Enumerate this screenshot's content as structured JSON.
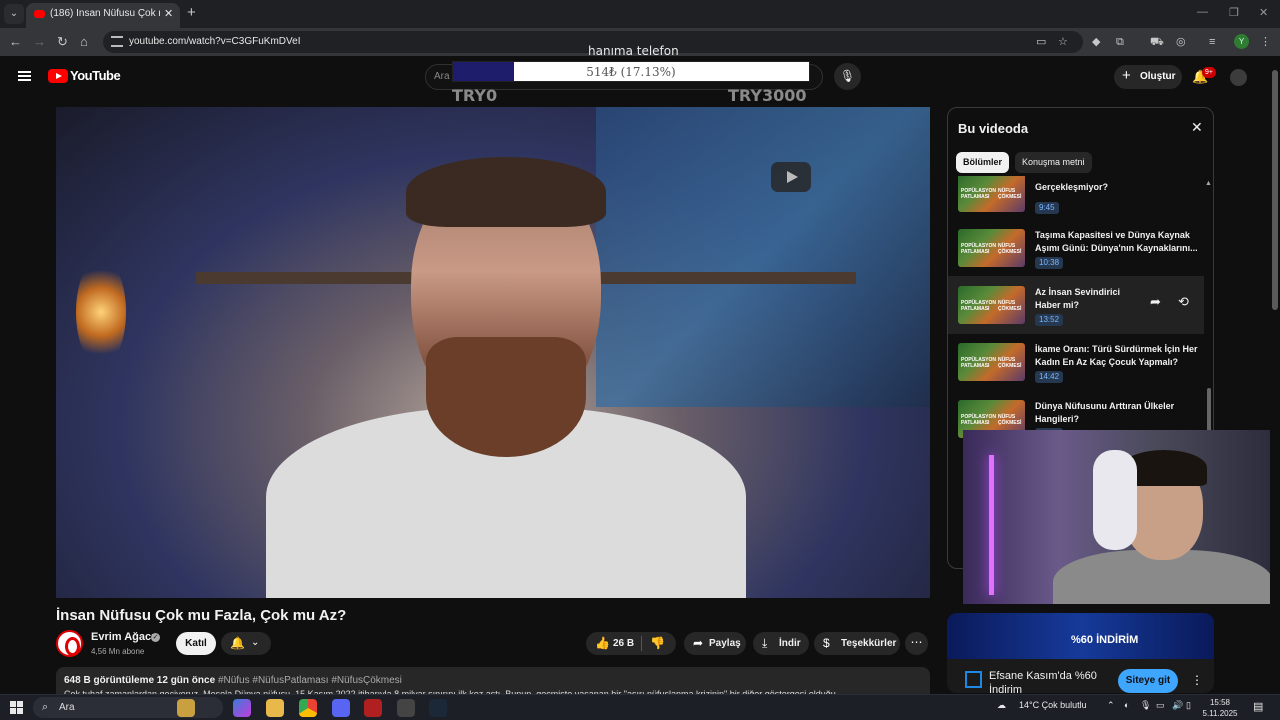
{
  "browser": {
    "tab_title": "(186) İnsan Nüfusu Çok mu Fazla, Çok mu Az?",
    "url": "youtube.com/watch?v=C3GFuKmDVeI",
    "profile_initial": "Y"
  },
  "yt_header": {
    "logo_text": "YouTube",
    "search_placeholder": "Ara",
    "create_label": "Oluştur",
    "notification_count": "9+"
  },
  "stream_overlay": {
    "goal_title": "hanıma telefon",
    "progress_text": "514₺ (17.13%)",
    "progress_fraction": 0.1713,
    "min_label": "TRY0",
    "max_label": "TRY3000"
  },
  "video": {
    "title": "İnsan Nüfusu Çok mu Fazla, Çok mu Az?",
    "channel_name": "Evrim Ağacı",
    "subscribers": "4,56 Mn abone",
    "join_label": "Katıl",
    "like_count": "26 B",
    "share_label": "Paylaş",
    "download_label": "İndir",
    "thanks_label": "Teşekkürler",
    "views_time": "648 B görüntüleme  12 gün önce",
    "hashtags": "#Nüfus #NüfusPatlaması #NüfusÇökmesi",
    "description_line": "Çok tuhaf zamanlardan geçiyoruz. Mesela Dünya nüfusu, 15 Kasım 2022 itibarıyla 8 milyar sınırını ilk kez aştı. Bunun, geçmişte yaşanan bir \"aşırı nüfuslanma krizinin\" bir diğer göstergesi olduğu..."
  },
  "chapters": {
    "heading": "Bu videoda",
    "tab_chapters": "Bölümler",
    "tab_transcript": "Konuşma metni",
    "thumb_text_left": "POPÜLASYON PATLAMASI",
    "thumb_text_right": "NÜFUS ÇÖKMESİ",
    "items": [
      {
        "title": "Gerçekleşmiyor?",
        "time": "9:45"
      },
      {
        "title": "Taşıma Kapasitesi ve Dünya Kaynak Aşımı Günü: Dünya'nın Kaynaklarını...",
        "time": "10:38"
      },
      {
        "title": "Az İnsan Sevindirici Haber mi?",
        "time": "13:52"
      },
      {
        "title": "İkame Oranı: Türü Sürdürmek İçin Her Kadın En Az Kaç Çocuk Yapmalı?",
        "time": "14:42"
      },
      {
        "title": "Dünya Nüfusunu Arttıran Ülkeler Hangileri?",
        "time": "16:02"
      }
    ]
  },
  "ad": {
    "banner_text": "%60 İNDİRİM",
    "title": "Efsane Kasım'da %60 İndirim",
    "cta": "Siteye git"
  },
  "taskbar": {
    "search_placeholder": "Ara",
    "weather": "14°C  Çok bulutlu",
    "time": "15:58",
    "date": "5.11.2025"
  }
}
